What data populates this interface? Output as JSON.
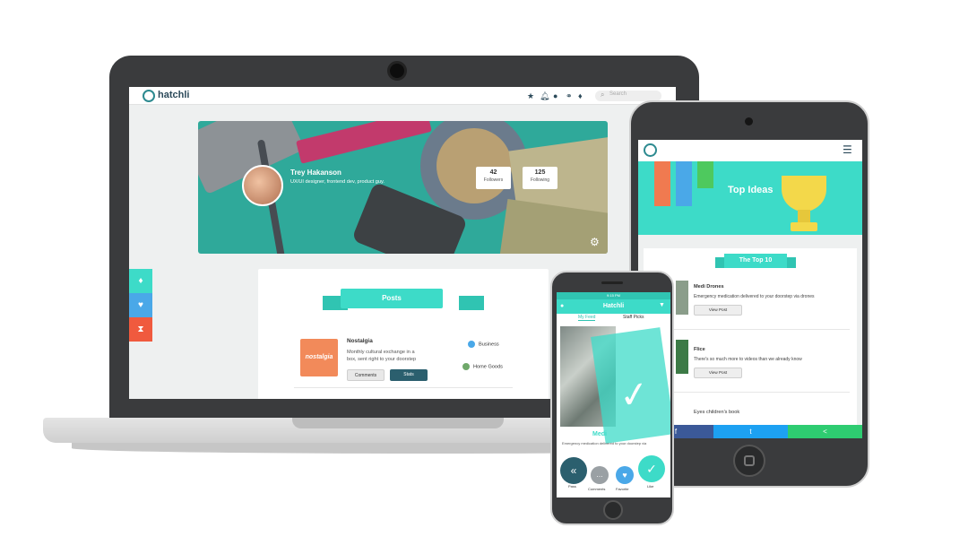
{
  "laptop": {
    "brand": "hatchli",
    "search_placeholder": "Search",
    "nav_icons": [
      "star-icon",
      "bell-icon",
      "user-icon",
      "people-icon",
      "lightbulb-icon"
    ],
    "profile": {
      "name": "Trey Hakanson",
      "bio": "UX/UI designer, frontend dev, product guy.",
      "followers_count": "42",
      "followers_label": "Followers",
      "following_count": "125",
      "following_label": "Following"
    },
    "side_tabs": [
      {
        "icon": "lightbulb-icon",
        "color": "#3ddbc8"
      },
      {
        "icon": "heart-icon",
        "color": "#4aa8e8"
      },
      {
        "icon": "hourglass-icon",
        "color": "#f05a3e"
      }
    ],
    "posts": {
      "heading": "Posts",
      "item": {
        "thumb_text": "nostalgia",
        "title": "Nostalgia",
        "description": "Monthly cultural exchange in a box, sent right to your doorstep",
        "comments_label": "Comments",
        "stats_label": "Stats",
        "categories": [
          "Business",
          "Home Goods"
        ]
      }
    }
  },
  "tablet": {
    "hero_title": "Top Ideas",
    "list_heading": "The Top 10",
    "items": [
      {
        "title": "Medi Drones",
        "description": "Emergency medication delivered to your doorstep via drones",
        "button": "View Post"
      },
      {
        "title": "Flice",
        "description": "There's so much more to videos than we already know",
        "button": "View Post"
      },
      {
        "title": "Eyes children's book",
        "description": "",
        "button": ""
      }
    ],
    "share": [
      {
        "icon": "facebook-icon",
        "glyph": "f",
        "color": "#3b5998"
      },
      {
        "icon": "twitter-icon",
        "glyph": "t",
        "color": "#1da1f2"
      },
      {
        "icon": "share-icon",
        "glyph": "<",
        "color": "#2ecc71"
      }
    ]
  },
  "phone": {
    "status": "9:15 PM",
    "title": "Hatchli",
    "tabs": [
      "My Feed",
      "Staff Picks"
    ],
    "card_title": "Medi",
    "card_desc": "Emergency medication delivered to your doorstep via",
    "actions": [
      {
        "label": "Pass",
        "color": "#2b5f6e"
      },
      {
        "label": "Comments",
        "color": "#9aa0a4"
      },
      {
        "label": "Favorite",
        "color": "#4aa8e8"
      },
      {
        "label": "Like",
        "color": "#3ddbc8"
      }
    ]
  }
}
